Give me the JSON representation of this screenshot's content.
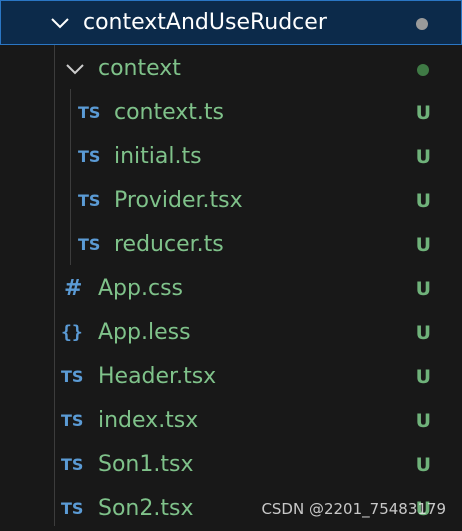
{
  "explorer": {
    "root_folder": {
      "name": "contextAndUseRudcer",
      "dot_color": "#9a9a9a"
    },
    "sub_folder": {
      "name": "context",
      "dot_color": "#3f7a45"
    },
    "folder_files": [
      {
        "icon": "TS",
        "name": "context.ts",
        "status": "U"
      },
      {
        "icon": "TS",
        "name": "initial.ts",
        "status": "U"
      },
      {
        "icon": "TS",
        "name": "Provider.tsx",
        "status": "U"
      },
      {
        "icon": "TS",
        "name": "reducer.ts",
        "status": "U"
      }
    ],
    "root_files": [
      {
        "icon": "#",
        "name": "App.css",
        "status": "U"
      },
      {
        "icon": "{}",
        "name": "App.less",
        "status": "U"
      },
      {
        "icon": "TS",
        "name": "Header.tsx",
        "status": "U"
      },
      {
        "icon": "TS",
        "name": "index.tsx",
        "status": "U"
      },
      {
        "icon": "TS",
        "name": "Son1.tsx",
        "status": "U"
      },
      {
        "icon": "TS",
        "name": "Son2.tsx",
        "status": "U"
      }
    ]
  },
  "colors": {
    "background": "#181818",
    "selected_bg": "#0c2a4a",
    "selected_border": "#2a76c4",
    "untracked_text": "#7fc28a",
    "ts_icon": "#5b9bd5"
  },
  "watermark": "CSDN @2201_75483179"
}
